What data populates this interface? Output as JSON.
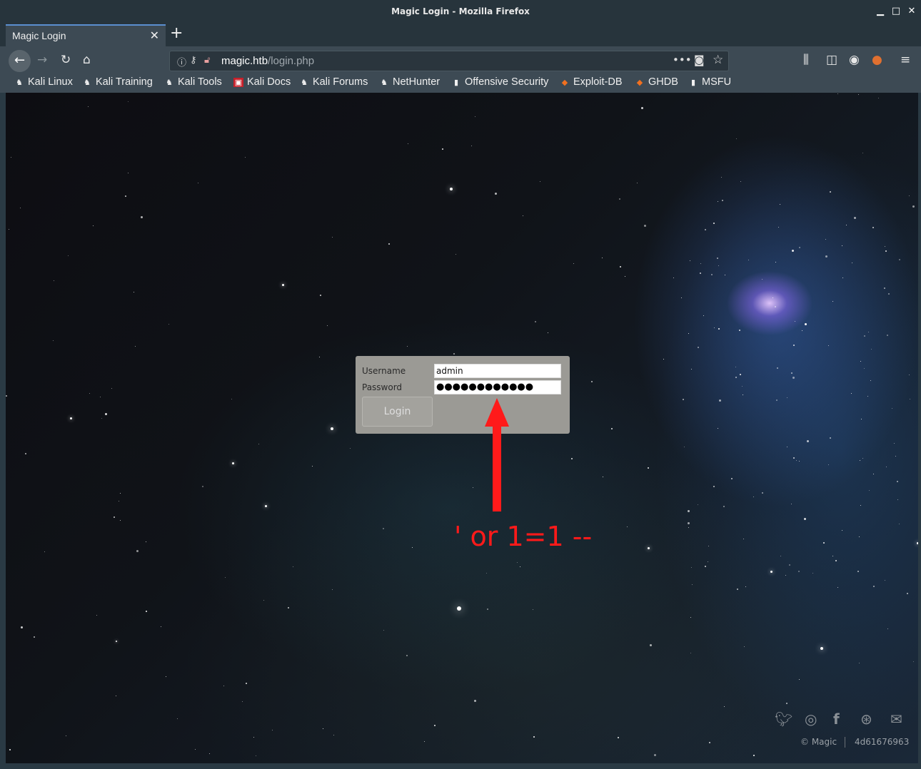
{
  "window": {
    "title": "Magic Login - Mozilla Firefox"
  },
  "tab": {
    "label": "Magic Login",
    "close": "✕"
  },
  "nav": {
    "url_host": "magic.htb",
    "url_path": "/login.php"
  },
  "bookmarks": [
    {
      "label": "Kali Linux"
    },
    {
      "label": "Kali Training"
    },
    {
      "label": "Kali Tools"
    },
    {
      "label": "Kali Docs"
    },
    {
      "label": "Kali Forums"
    },
    {
      "label": "NetHunter"
    },
    {
      "label": "Offensive Security"
    },
    {
      "label": "Exploit-DB"
    },
    {
      "label": "GHDB"
    },
    {
      "label": "MSFU"
    }
  ],
  "login": {
    "username_label": "Username",
    "password_label": "Password",
    "username_value": "admin",
    "password_mask": "●●●●●●●●●●●●",
    "button_label": "Login"
  },
  "annotation": {
    "text": "' or 1=1 --",
    "color": "#ff1a1a"
  },
  "footer": {
    "copyright": "© Magic",
    "hash": "4d61676963",
    "social_icons": [
      "twitter-icon",
      "instagram-icon",
      "facebook-icon",
      "dribbble-icon",
      "envelope-icon"
    ]
  }
}
